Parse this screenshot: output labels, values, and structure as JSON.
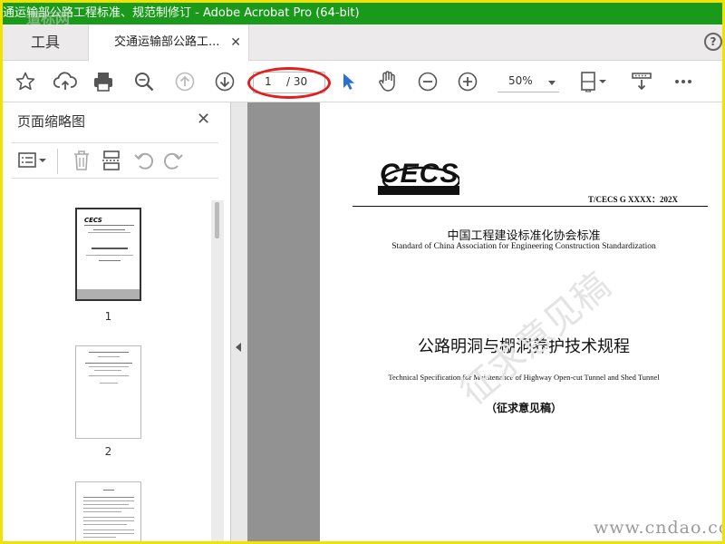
{
  "window": {
    "title": "通运输部公路工程标准、规范制修订 - Adobe Acrobat Pro (64-bit)"
  },
  "tabs": {
    "tools_label": "工具",
    "doc_label": "交通运输部公路工...",
    "close_glyph": "✕"
  },
  "help": {
    "glyph": "?"
  },
  "toolbar": {
    "page_current": "1",
    "page_total": "/ 30",
    "zoom": "50%"
  },
  "sidebar": {
    "title": "页面缩略图",
    "close_glyph": "✕",
    "thumbnails": [
      {
        "label": "1"
      },
      {
        "label": "2"
      },
      {
        "label": ""
      }
    ]
  },
  "document": {
    "logo_text": "CECS",
    "standard_number": "T/CECS G XXXX：202X",
    "org_cn": "中国工程建设标准化协会标准",
    "org_en": "Standard of China Association for Engineering Construction Standardization",
    "title_cn": "公路明洞与棚洞养护技术规程",
    "title_en": "Technical Specification for Maintenance of Highway Open-cut Tunnel and Shed Tunnel",
    "draft_label": "（征求意见稿）",
    "watermark": "征求意见稿"
  },
  "overlay": {
    "site_watermark": "www.cndao.com",
    "corner_watermark": "道标网"
  },
  "colors": {
    "titlebar": "#1a9a1a",
    "frame": "#f2e200",
    "annotation_oval": "#e02020",
    "doc_background": "#929292",
    "select_cursor": "#2b6fd6"
  }
}
